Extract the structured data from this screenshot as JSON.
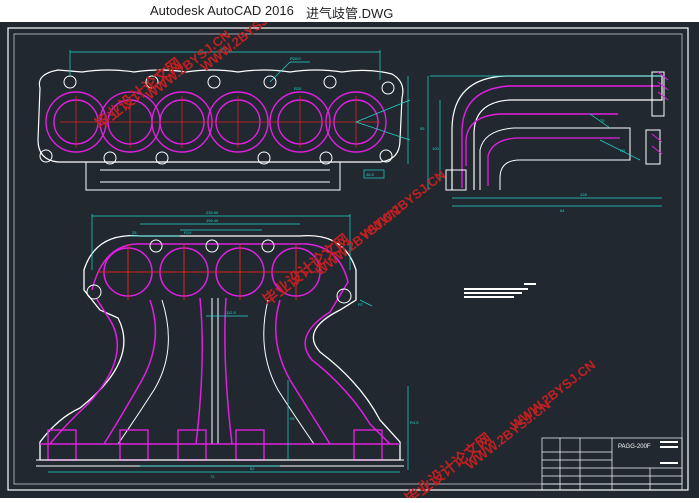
{
  "window": {
    "title_app": "Autodesk AutoCAD 2016",
    "title_file": "进气歧管.DWG"
  },
  "watermarks": [
    {
      "text": "毕业设计论文网"
    },
    {
      "text": "WWW.2BYSJ.CN"
    }
  ],
  "drawing": {
    "dims_top_view": [
      "R20/2",
      "R25",
      "180",
      "48.5"
    ],
    "dims_side_view": [
      "128",
      "64",
      "55",
      "100",
      "70",
      "R9"
    ],
    "dims_front_view": [
      "239.90",
      "199.40",
      "25",
      "R19",
      "R7",
      "112.5",
      "95",
      "R4.5",
      "72",
      "62"
    ],
    "title_block": {
      "drawing_no": "PAGG-200F"
    }
  },
  "colors": {
    "background": "#212830",
    "outline": "#ffffff",
    "hidden_lines": "#e020e0",
    "dimensions": "#20d8d0",
    "center_lines": "#e02020",
    "watermark": "#c02020"
  }
}
